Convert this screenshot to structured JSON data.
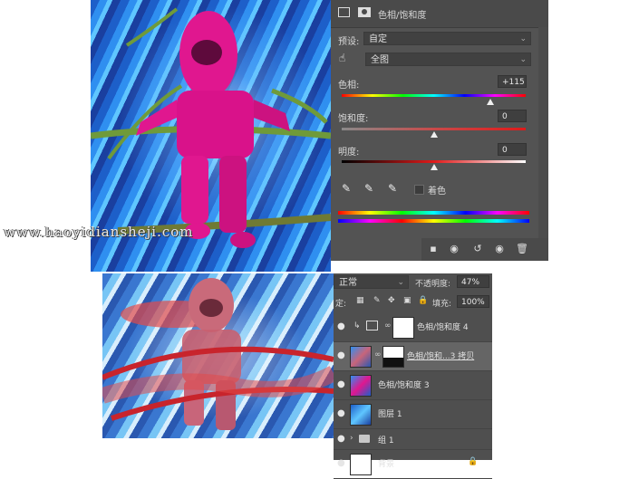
{
  "properties": {
    "title": "色相/饱和度",
    "preset_label": "预设:",
    "preset_value": "自定",
    "channel_value": "全图",
    "hue": {
      "label": "色相:",
      "value": "+115",
      "level": 0.81
    },
    "saturation": {
      "label": "饱和度:",
      "value": "0",
      "level": 0.5
    },
    "lightness": {
      "label": "明度:",
      "value": "0",
      "level": 0.5
    },
    "colorize_label": "着色"
  },
  "layers": {
    "blend_mode": "正常",
    "opacity_label": "不透明度:",
    "opacity_value": "47%",
    "lock_label": "定:",
    "fill_label": "填充:",
    "fill_value": "100%",
    "items": [
      {
        "name": "色相/饱和度 4"
      },
      {
        "name": "色相/饱和...3 拷贝"
      },
      {
        "name": "色相/饱和度 3"
      },
      {
        "name": "图层 1"
      },
      {
        "name": "组 1"
      },
      {
        "name": "背景"
      }
    ]
  },
  "watermark": "www.haoyidiansheji.com",
  "colors": {
    "panel_bg": "#535353",
    "astronaut_magenta": "#e0178f",
    "sky_blue": "#2f8ff0"
  }
}
